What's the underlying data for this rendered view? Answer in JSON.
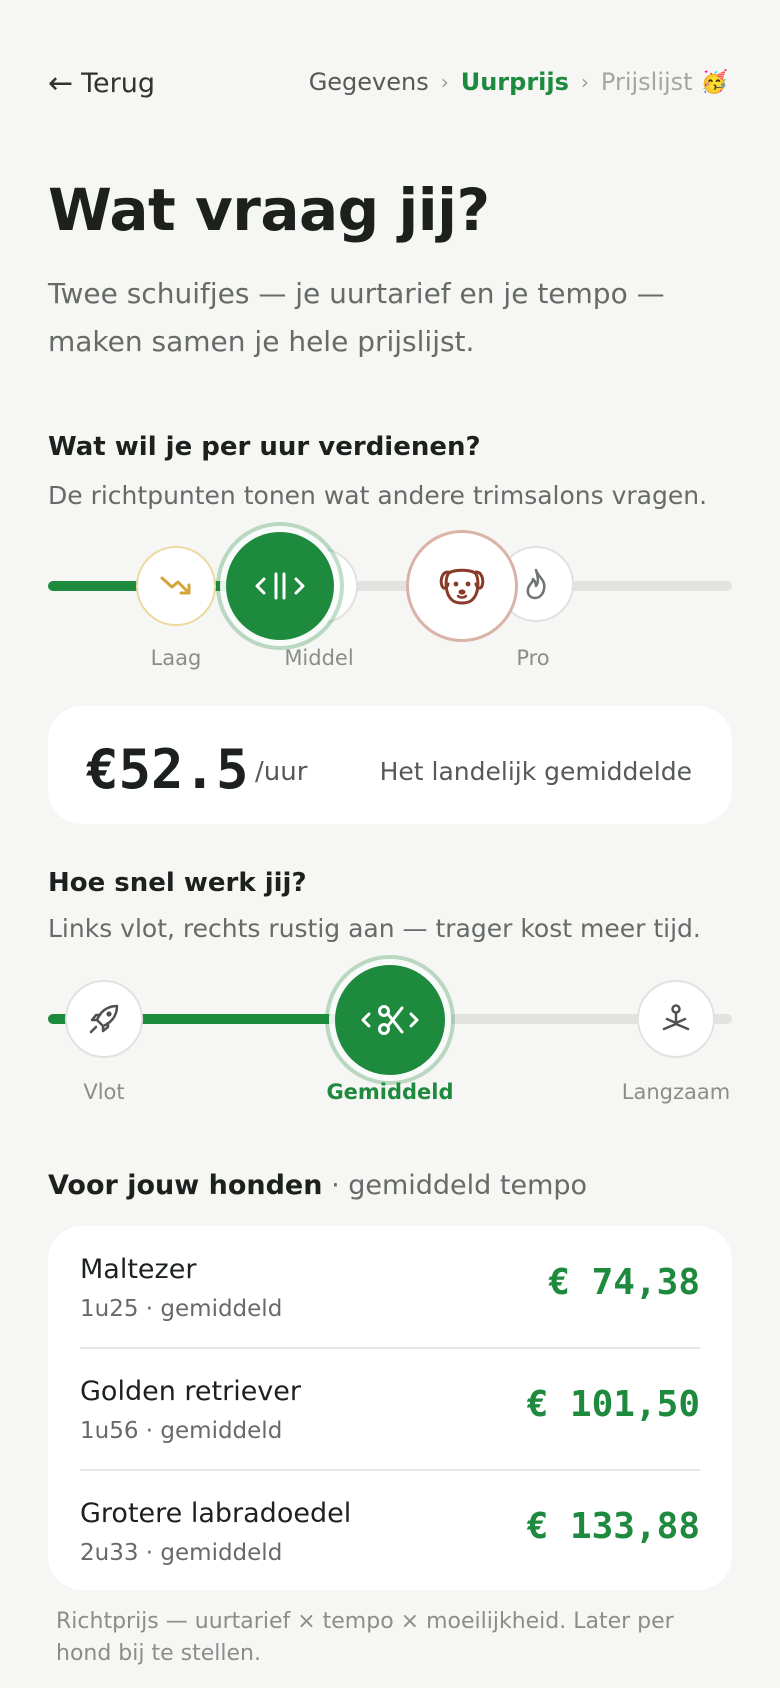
{
  "header": {
    "back_arrow": "←",
    "back_label": "Terug",
    "breadcrumbs": [
      "Gegevens",
      "Uurprijs",
      "Prijslijst"
    ],
    "breadcrumb_sep": "›",
    "breadcrumb_emoji": "🥳"
  },
  "title": "Wat vraag jij?",
  "subtitle": "Twee schuifjes — je uurtarief en je tempo — maken samen je hele prijslijst.",
  "rate": {
    "question": "Wat wil je per uur verdienen?",
    "hint": "De richtpunten tonen wat andere trimsalons vragen.",
    "levels": [
      "Laag",
      "Middel",
      "Pro"
    ],
    "value": "€52.5",
    "unit": "/uur",
    "caption": "Het landelijk gemiddelde"
  },
  "tempo": {
    "question": "Hoe snel werk jij?",
    "hint": "Links vlot, rechts rustig aan — trager kost meer tijd.",
    "levels": [
      "Vlot",
      "Gemiddeld",
      "Langzaam"
    ]
  },
  "dogs": {
    "heading": "Voor jouw honden",
    "heading_suffix": "· gemiddeld tempo",
    "items": [
      {
        "name": "Maltezer",
        "meta": "1u25 · gemiddeld",
        "price": "€ 74,38"
      },
      {
        "name": "Golden retriever",
        "meta": "1u56 · gemiddeld",
        "price": "€ 101,50"
      },
      {
        "name": "Grotere labradoedel",
        "meta": "2u33 · gemiddeld",
        "price": "€ 133,88"
      }
    ]
  },
  "footnote": "Richtprijs — uurtarief × tempo × moeilijkheid. Later per hond bij te stellen.",
  "colors": {
    "accent": "#1e8a3e",
    "background": "#f6f6f4",
    "dog_ring": "#d9b3a8",
    "low_ring": "#ecd9a0"
  }
}
